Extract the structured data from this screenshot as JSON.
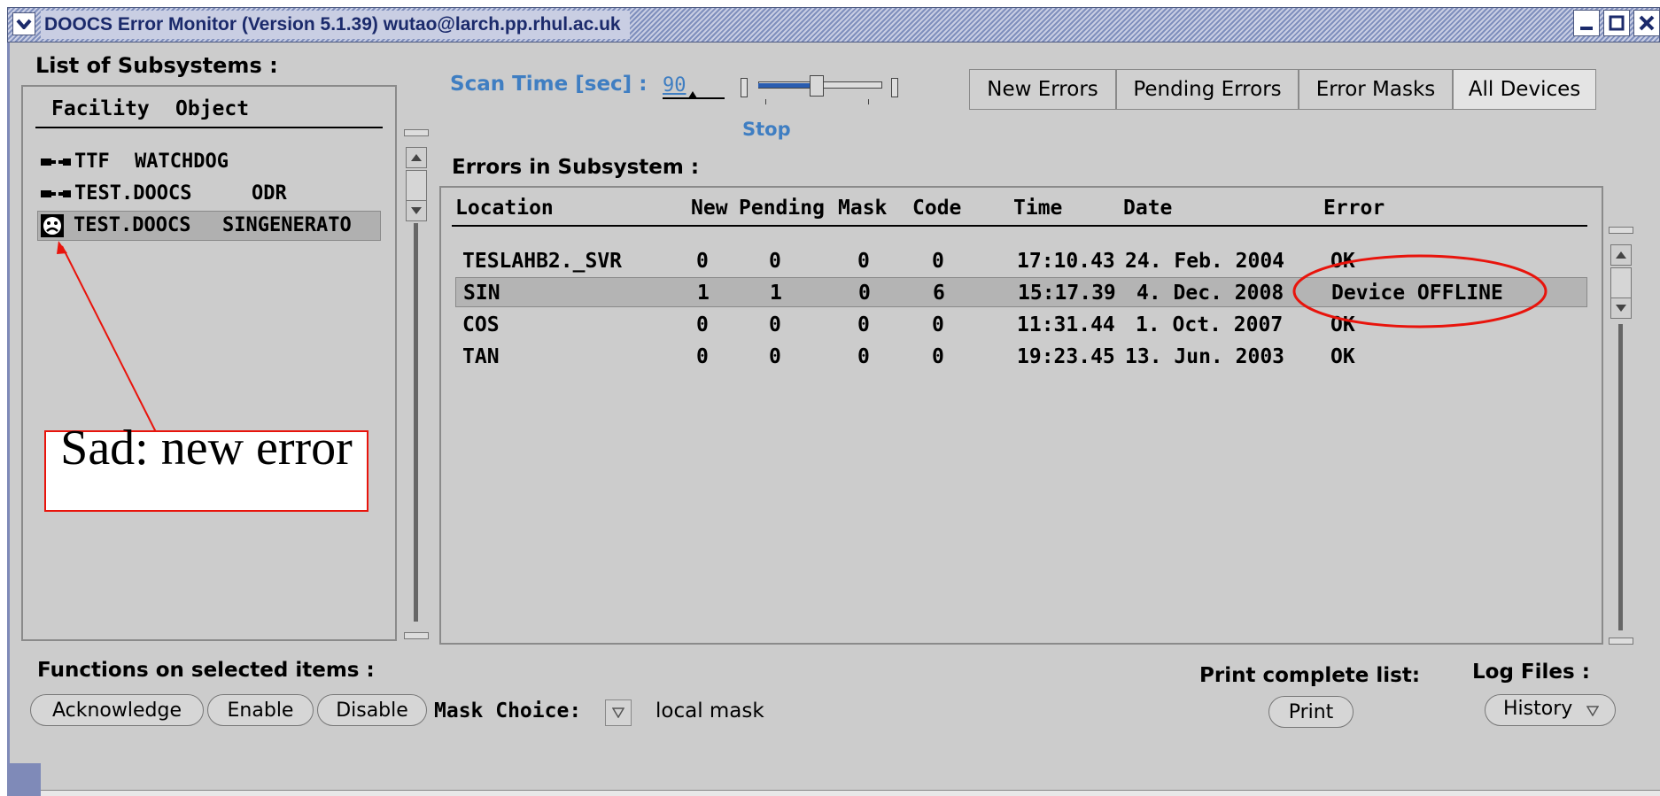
{
  "window": {
    "title": "DOOCS Error Monitor  (Version 5.1.39)   wutao@larch.pp.rhul.ac.uk"
  },
  "left": {
    "heading": "List of Subsystems :",
    "col_facility": "Facility",
    "col_object": "Object",
    "items": [
      {
        "facility": "TTF",
        "object": "WATCHDOG",
        "icon": "plug-icon"
      },
      {
        "facility": "TEST.DOOCS",
        "object": "ODR",
        "icon": "plug-icon"
      },
      {
        "facility": "TEST.DOOCS",
        "object": "SINGENERATO",
        "icon": "sad-face-icon"
      }
    ]
  },
  "scan": {
    "label": "Scan Time [sec] :",
    "value": "90",
    "stop": "Stop"
  },
  "tabs": [
    "New Errors",
    "Pending Errors",
    "Error Masks",
    "All Devices"
  ],
  "errors": {
    "heading": "Errors in Subsystem :",
    "columns": [
      "Location",
      "New",
      "Pending",
      "Mask",
      "Code",
      "Time",
      "Date",
      "Error"
    ],
    "rows": [
      {
        "location": "TESLAHB2._SVR",
        "new": "0",
        "pending": "0",
        "mask": "0",
        "code": "0",
        "time": "17:10.43",
        "date": "24. Feb. 2004",
        "error": "OK"
      },
      {
        "location": "SIN",
        "new": "1",
        "pending": "1",
        "mask": "0",
        "code": "6",
        "time": "15:17.39",
        "date": "4. Dec. 2008",
        "error": "Device OFFLINE"
      },
      {
        "location": "COS",
        "new": "0",
        "pending": "0",
        "mask": "0",
        "code": "0",
        "time": "11:31.44",
        "date": "1. Oct. 2007",
        "error": "OK"
      },
      {
        "location": "TAN",
        "new": "0",
        "pending": "0",
        "mask": "0",
        "code": "0",
        "time": "19:23.45",
        "date": "13. Jun. 2003",
        "error": "OK"
      }
    ]
  },
  "functions": {
    "heading": "Functions on selected items :",
    "acknowledge": "Acknowledge",
    "enable": "Enable",
    "disable": "Disable",
    "mask_choice_label": "Mask Choice:",
    "mask_choice_value": "local mask"
  },
  "print": {
    "label": "Print complete list:",
    "button": "Print"
  },
  "log": {
    "label": "Log Files :",
    "button": "History"
  },
  "annotation": {
    "text": "Sad: new error",
    "color": "#e8140c"
  }
}
